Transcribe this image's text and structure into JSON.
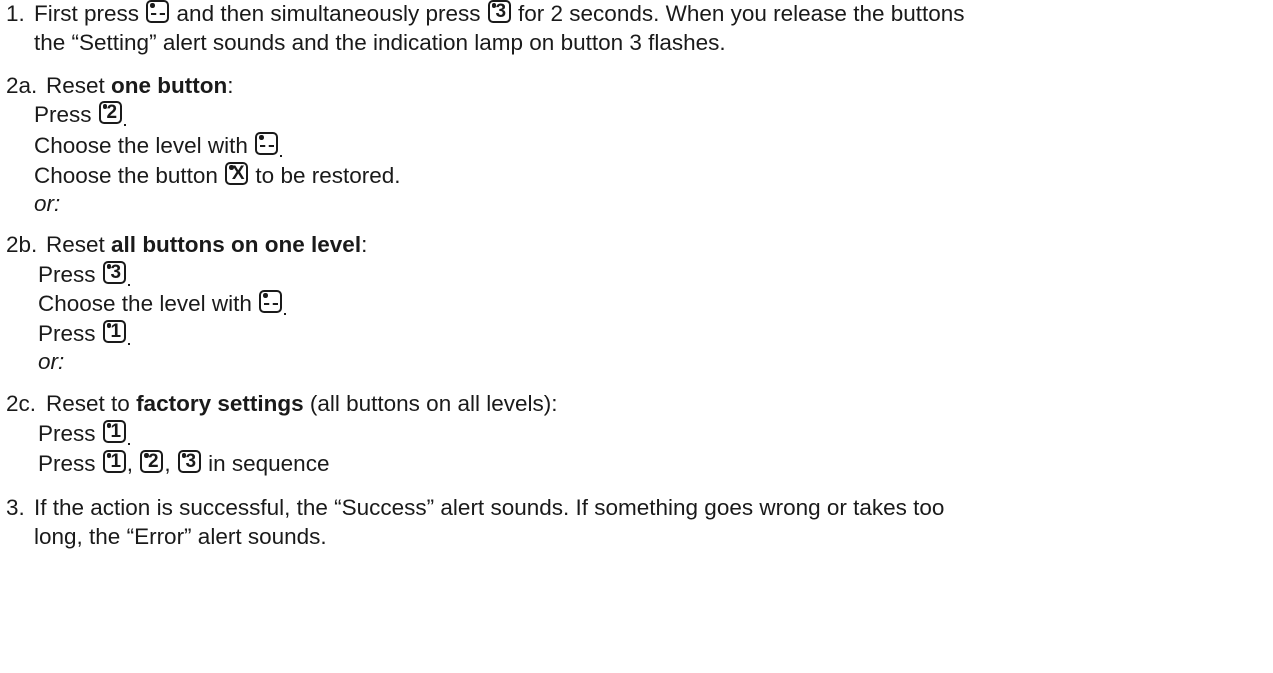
{
  "steps": {
    "s1": {
      "number": "1.",
      "a": "First press",
      "b": "and then simultaneously press",
      "c": "for 2 seconds. When you release the buttons",
      "d": "the “Setting” alert sounds and the indication lamp on button 3 flashes."
    },
    "s2a": {
      "number": "2a.",
      "a": "Reset",
      "bold": "one button",
      "colon": ":",
      "press": "Press",
      "choose_level": "Choose the level with",
      "choose_btn_a": "Choose the button",
      "choose_btn_b": "to be restored.",
      "or": "or:"
    },
    "s2b": {
      "number": "2b.",
      "a": "Reset",
      "bold": "all buttons on one level",
      "colon": ":",
      "press1": "Press",
      "choose_level": "Choose the level with",
      "press2": "Press",
      "or": "or:"
    },
    "s2c": {
      "number": "2c.",
      "a": "Reset to",
      "bold": "factory settings",
      "rest": "(all buttons on all levels):",
      "press1": "Press",
      "press2": "Press",
      "comma": ",",
      "seq": "in sequence"
    },
    "s3": {
      "number": "3.",
      "a": "If the action is successful, the “Success” alert sounds. If something goes wrong or takes too",
      "b": "long, the “Error” alert sounds."
    }
  },
  "keys": {
    "level": "---",
    "k1": "1",
    "k2": "2",
    "k3": "3",
    "kx": "X"
  }
}
